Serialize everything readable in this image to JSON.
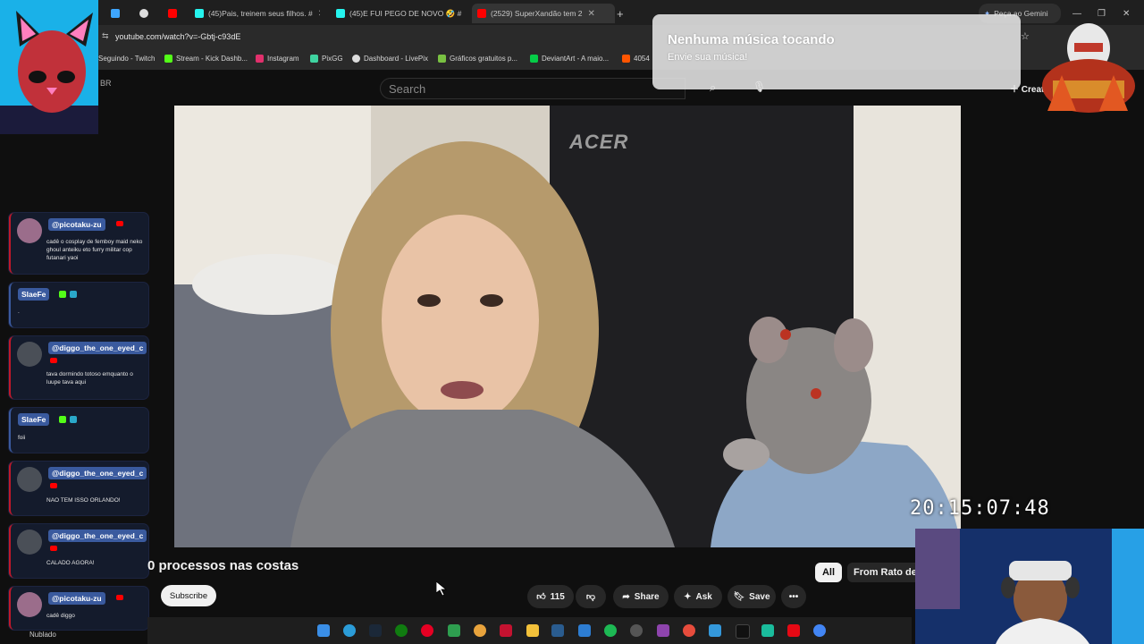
{
  "browser": {
    "tabs": [
      {
        "label": "",
        "color": "#3ea6ff"
      },
      {
        "label": "",
        "color": "#ff0000"
      },
      {
        "label": "(45)Pais, treinem seus filhos. #",
        "color": "#25f4ee"
      },
      {
        "label": "(45)E FUI PEGO DE NOVO 🤣 #",
        "color": "#25f4ee"
      },
      {
        "label": "(2529) SuperXandão tem 2",
        "color": "#ff0000",
        "active": true
      }
    ],
    "new_tab": "+",
    "gemini_label": "Peça ao Gemini",
    "url": "youtube.com/watch?v=-Gbtj-c93dE",
    "bookmarks": [
      {
        "label": "Seguindo - Twitch",
        "color": "#9146ff"
      },
      {
        "label": "Stream - Kick Dashb...",
        "color": "#53fc18"
      },
      {
        "label": "Instagram",
        "color": "#e1306c"
      },
      {
        "label": "PixGG",
        "color": "#3fd3a0"
      },
      {
        "label": "Dashboard - LivePix",
        "color": "#dddddd"
      },
      {
        "label": "Gráficos gratuitos p...",
        "color": "#79c142"
      },
      {
        "label": "DeviantArt - A maio...",
        "color": "#05cc47"
      },
      {
        "label": "4054",
        "color": "#ff5500"
      }
    ]
  },
  "youtube": {
    "country": "BR",
    "search_placeholder": "Search",
    "create_label": "Creat",
    "video_title": "0 processos nas costas",
    "subscribe_label": "Subscribe",
    "likes": "115",
    "share_label": "Share",
    "ask_label": "Ask",
    "save_label": "Save",
    "chips": {
      "all": "All",
      "from": "From Rato de"
    }
  },
  "music_popup": {
    "title": "Nenhuma música tocando",
    "subtitle": "Envie sua música!"
  },
  "overlay": {
    "clock": "20:15:07:48",
    "video_brand": "ACER"
  },
  "chat": [
    {
      "user": "@picotaku-zu",
      "message": "cadê o cosplay de femboy maid neko ghoul anteiku eto furry militar cop futanari yaoi",
      "avatar": true
    },
    {
      "user": "SlaeFe",
      "message": ".",
      "avatar": false
    },
    {
      "user": "@diggo_the_one_eyed_c",
      "message": "tava dormindo totoso emquanto o luupe tava aqui",
      "avatar": true
    },
    {
      "user": "SlaeFe",
      "message": "foii",
      "avatar": false
    },
    {
      "user": "@diggo_the_one_eyed_c",
      "message": "NAO TEM ISSO ORLANDO!",
      "avatar": true
    },
    {
      "user": "@diggo_the_one_eyed_c",
      "message": "CALADO AGORA!",
      "avatar": true
    },
    {
      "user": "@picotaku-zu",
      "message": "cadê diggo",
      "avatar": true
    }
  ],
  "system": {
    "weather": "Nublado"
  }
}
